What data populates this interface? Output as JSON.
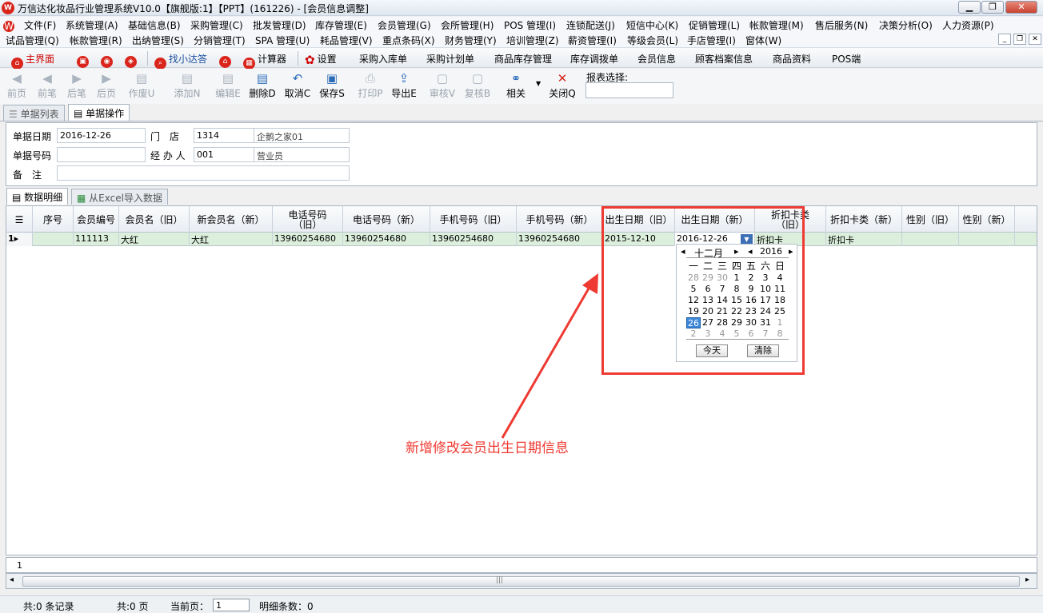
{
  "window": {
    "title": "万信达化妆品行业管理系统V10.0【旗舰版:1】【PPT】(161226) - [会员信息调整]"
  },
  "menu1": [
    "文件(F)",
    "系统管理(A)",
    "基础信息(B)",
    "采购管理(C)",
    "批发管理(D)",
    "库存管理(E)",
    "会员管理(G)",
    "会所管理(H)",
    "POS 管理(I)",
    "连锁配送(J)",
    "短信中心(K)",
    "促销管理(L)",
    "帐款管理(M)",
    "售后服务(N)",
    "决策分析(O)",
    "人力资源(P)"
  ],
  "menu2": [
    "试品管理(Q)",
    "帐款管理(R)",
    "出纳管理(S)",
    "分销管理(T)",
    "SPA 管理(U)",
    "耗品管理(V)",
    "重点条码(X)",
    "财务管理(Y)",
    "培训管理(Z)",
    "薪资管理(I)",
    "等级会员(L)",
    "手店管理(I)",
    "窗体(W)"
  ],
  "quickbar": {
    "home": "主界面",
    "find": "找小达答",
    "calc": "计算器",
    "settings": "设置",
    "links": [
      "采购入库单",
      "采购计划单",
      "商品库存管理",
      "库存调拨单",
      "会员信息",
      "顾客档案信息",
      "商品资料",
      "POS端"
    ]
  },
  "toolbar": {
    "first": "前页",
    "prev": "前笔",
    "next": "后笔",
    "last": "后页",
    "void": "作废U",
    "add": "添加N",
    "edit": "编辑E",
    "delete": "删除D",
    "cancel": "取消C",
    "save": "保存S",
    "print": "打印P",
    "export": "导出E",
    "audit": "审核V",
    "recheck": "复核B",
    "related": "相关",
    "close": "关闭Q",
    "report_label": "报表选择:",
    "report_value": ""
  },
  "tabs": {
    "list": "单据列表",
    "operate": "单据操作"
  },
  "form": {
    "date_label": "单据日期",
    "date_value": "2016-12-26",
    "store_label": "门　店",
    "store_code": "1314",
    "store_name": "企鹅之家01",
    "no_label": "单据号码",
    "no_value": "",
    "handler_label": "经 办 人",
    "handler_code": "001",
    "handler_name": "营业员",
    "remark_label": "备　注",
    "remark_value": ""
  },
  "subtabs": {
    "detail": "数据明细",
    "excel": "从Excel导入数据"
  },
  "grid": {
    "headers": [
      "序号",
      "会员编号",
      "会员名（旧）",
      "新会员名（新）",
      "电话号码（旧）",
      "电话号码（新）",
      "手机号码（旧）",
      "手机号码（新）",
      "出生日期（旧）",
      "出生日期（新）",
      "折扣卡类（旧）",
      "折扣卡类（新）",
      "性别（旧）",
      "性别（新）"
    ],
    "row": {
      "marker": "1",
      "seq": "",
      "member_no": "111113",
      "name_old": "大红",
      "name_new": "大红",
      "tel_old": "13960254680",
      "tel_new": "13960254680",
      "mobile_old": "13960254680",
      "mobile_new": "13960254680",
      "birth_old": "2015-12-10",
      "birth_new": "2016-12-26",
      "card_old": "折扣卡",
      "card_new": "折扣卡"
    }
  },
  "calendar": {
    "month": "十二月",
    "year": "2016",
    "weekdays": [
      "一",
      "二",
      "三",
      "四",
      "五",
      "六",
      "日"
    ],
    "weeks": [
      [
        "28",
        "29",
        "30",
        "1",
        "2",
        "3",
        "4"
      ],
      [
        "5",
        "6",
        "7",
        "8",
        "9",
        "10",
        "11"
      ],
      [
        "12",
        "13",
        "14",
        "15",
        "16",
        "17",
        "18"
      ],
      [
        "19",
        "20",
        "21",
        "22",
        "23",
        "24",
        "25"
      ],
      [
        "26",
        "27",
        "28",
        "29",
        "30",
        "31",
        "1"
      ],
      [
        "2",
        "3",
        "4",
        "5",
        "6",
        "7",
        "8"
      ]
    ],
    "selected_day": "26",
    "today_button": "今天",
    "clear_button": "清除"
  },
  "annotation": "新增修改会员出生日期信息",
  "pager": {
    "page_number": "1"
  },
  "status": {
    "records": "共:0 条记录",
    "pages": "共:0 页",
    "current_label": "当前页：",
    "current_value": "1",
    "detail_count": "明细条数：0"
  },
  "colors": {
    "annotation_red": "#ee3a32",
    "row_highlight": "#dcefdc",
    "selected_day": "#3c87d8"
  }
}
